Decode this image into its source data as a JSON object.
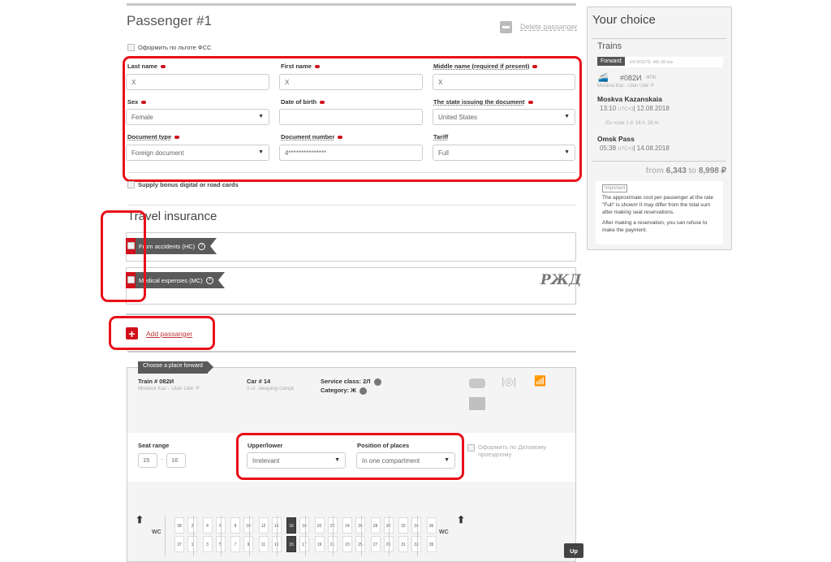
{
  "passenger": {
    "title": "Passenger #1",
    "delete_label": "Delete passanger",
    "fss_label": "Оформить по льготе ФСС",
    "fields": {
      "last_name": {
        "label": "Last name",
        "value": "X"
      },
      "first_name": {
        "label": "First name",
        "value": "X"
      },
      "middle_name": {
        "label": "Middle name (required if present)",
        "value": "X"
      },
      "sex": {
        "label": "Sex",
        "value": "Female"
      },
      "dob": {
        "label": "Date of birth",
        "value": ""
      },
      "state": {
        "label": "The state issuing the document",
        "value": "United States"
      },
      "doc_type": {
        "label": "Document type",
        "value": "Foreign document"
      },
      "doc_number": {
        "label": "Document number",
        "value": "4***************"
      },
      "tariff": {
        "label": "Tariff",
        "value": "Full"
      }
    },
    "bonus_label": "Supply bonus digital or road cards"
  },
  "insurance": {
    "title": "Travel insurance",
    "items": [
      {
        "label": "From accidents (НС)",
        "help": "?"
      },
      {
        "label": "Medical expenses (МС)",
        "help": "?"
      }
    ],
    "logo": "РЖД"
  },
  "add_passenger": {
    "label": "Add passanger",
    "icon": "+"
  },
  "place": {
    "tab": "Choose a place forward",
    "train_label": "Train # 082И",
    "train_route": "Moskva Kaz - Ulan Ude' P",
    "car_label": "Car # 14",
    "car_type": "2-cl. sleeping compt.",
    "service_class": "Service class: 2Л",
    "category": "Category: Ж",
    "seat_range_label": "Seat range",
    "seat_from": "15",
    "seat_to": "16",
    "seat_dash": "-",
    "upper_lower_label": "Upper/lower",
    "upper_lower_value": "Irrelevant",
    "position_label": "Position of places",
    "position_value": "In one compartment",
    "business_label": "Оформить по Деловому проездному",
    "wc": "WC",
    "up_button": "Up",
    "seats_top": [
      "38",
      "2",
      "4",
      "6",
      "8",
      "10",
      "12",
      "14",
      "16",
      "18",
      "20",
      "22",
      "24",
      "26",
      "28",
      "30",
      "32",
      "34",
      "36"
    ],
    "seats_bottom": [
      "37",
      "1",
      "3",
      "5",
      "7",
      "9",
      "11",
      "13",
      "15",
      "17",
      "19",
      "21",
      "23",
      "25",
      "27",
      "29",
      "31",
      "33",
      "35"
    ],
    "selected": [
      "16",
      "15"
    ]
  },
  "choice": {
    "title": "Your choice",
    "trains_label": "Trains",
    "direction": "Forward",
    "en_route": "EN ROUTE: 40h 28 min",
    "train_number": "#082И",
    "train_brand": "ФПК",
    "route": "Moskva Kaz - Ulan Ude' P",
    "from_station": "Moskva Kazanskaia",
    "from_time": "13:10",
    "tz": "UTC+3",
    "from_date": "12.08.2018",
    "duration": "En route  1 d. 16 h. 28 m.",
    "to_station": "Omsk Pass",
    "to_time": "05:38",
    "to_date": "14.08.2018",
    "price_from_word": "from",
    "price_from": "6,343",
    "price_to_word": "to",
    "price_to": "8,998 ₽",
    "important_tag": "Important",
    "note1": "The approximate cost per passenger at the rate \"Full\" is shown! It may differ from the total sum after making seat reservations.",
    "note2": "After making a reservation, you can refuse to make the payment."
  }
}
